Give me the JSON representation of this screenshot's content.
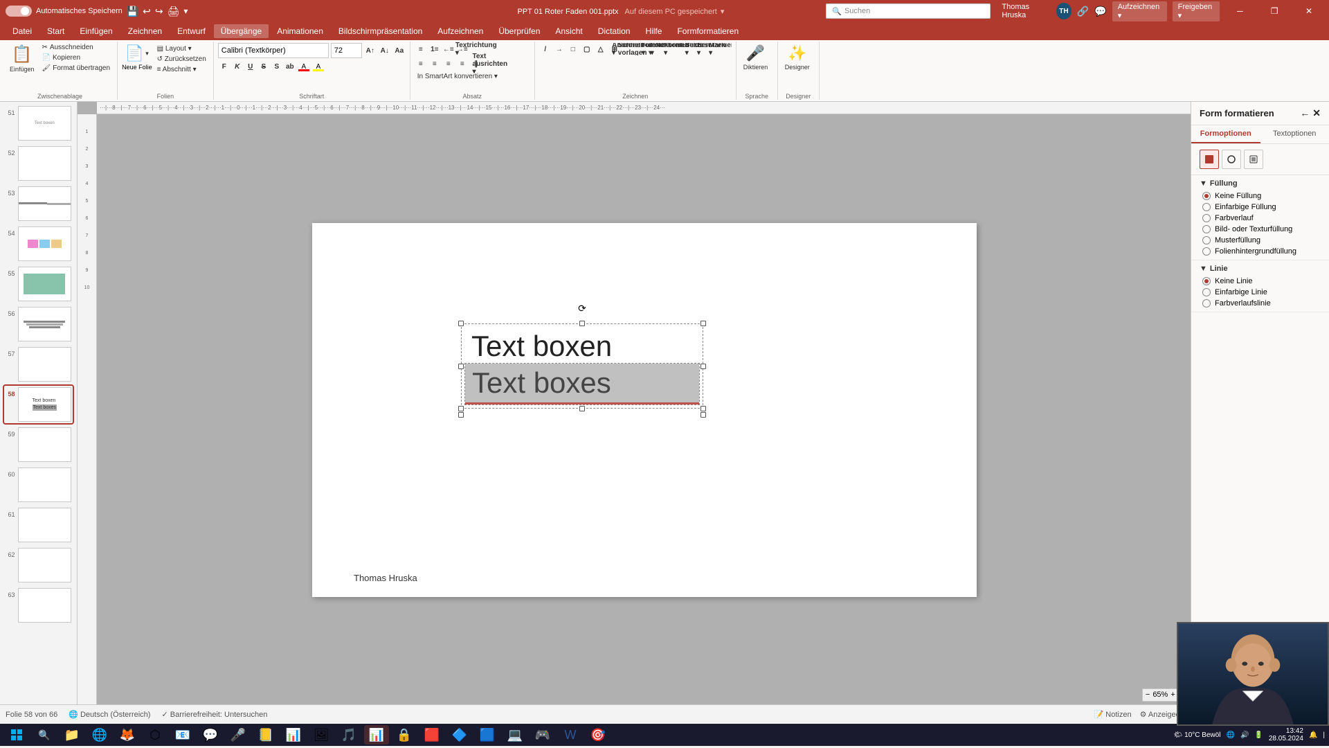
{
  "titlebar": {
    "autosave_label": "Automatisches Speichern",
    "file_title": "PPT 01 Roter Faden 001.pptx",
    "save_location": "Auf diesem PC gespeichert",
    "user_name": "Thomas Hruska",
    "user_initials": "TH",
    "search_placeholder": "Suchen",
    "win_minimize": "─",
    "win_restore": "❐",
    "win_close": "✕"
  },
  "menubar": {
    "items": [
      {
        "label": "Datei",
        "id": "datei"
      },
      {
        "label": "Start",
        "id": "start"
      },
      {
        "label": "Einfügen",
        "id": "einfuegen"
      },
      {
        "label": "Zeichnen",
        "id": "zeichnen"
      },
      {
        "label": "Entwurf",
        "id": "entwurf"
      },
      {
        "label": "Übergänge",
        "id": "uebergaenge",
        "active": true
      },
      {
        "label": "Animationen",
        "id": "animationen"
      },
      {
        "label": "Bildschirmpräsentation",
        "id": "bildschirm"
      },
      {
        "label": "Aufzeichnen",
        "id": "aufzeichnen"
      },
      {
        "label": "Überprüfen",
        "id": "ueberpruefen"
      },
      {
        "label": "Ansicht",
        "id": "ansicht"
      },
      {
        "label": "Dictation",
        "id": "dictation"
      },
      {
        "label": "Hilfe",
        "id": "hilfe"
      },
      {
        "label": "Formformatieren",
        "id": "formformatieren"
      }
    ]
  },
  "ribbon": {
    "active_tab": "Übergänge",
    "groups": [
      {
        "label": "Zwischenablage",
        "buttons": [
          {
            "label": "Neue Folie",
            "icon": "📄"
          },
          {
            "label": "Layout",
            "icon": "▤"
          },
          {
            "label": "Zurücksetzen",
            "icon": "↺"
          },
          {
            "label": "Abschnitt",
            "icon": "≡"
          }
        ]
      }
    ],
    "font_name": "Calibri (Textkörper)",
    "font_size": "72",
    "format_buttons": [
      "F",
      "K",
      "U",
      "S",
      "ab",
      "A"
    ],
    "group_labels": [
      "Zwischenablage",
      "Folien",
      "Schriftart",
      "Absatz",
      "Zeichnen",
      "Sprache",
      "Designer"
    ]
  },
  "slide_panel": {
    "slides": [
      {
        "num": "51",
        "active": false
      },
      {
        "num": "52",
        "active": false
      },
      {
        "num": "53",
        "active": false
      },
      {
        "num": "54",
        "active": false
      },
      {
        "num": "55",
        "active": false
      },
      {
        "num": "56",
        "active": false
      },
      {
        "num": "57",
        "active": false
      },
      {
        "num": "58",
        "active": true
      },
      {
        "num": "59",
        "active": false
      },
      {
        "num": "60",
        "active": false
      },
      {
        "num": "61",
        "active": false
      },
      {
        "num": "62",
        "active": false
      },
      {
        "num": "63",
        "active": false
      }
    ]
  },
  "canvas": {
    "slide_footer": "Thomas Hruska",
    "textbox_upper": "Text boxen",
    "textbox_lower": "Text boxes"
  },
  "right_panel": {
    "title": "Form formatieren",
    "tabs": [
      {
        "label": "Formoptionen",
        "active": true
      },
      {
        "label": "Textoptionen",
        "active": false
      }
    ],
    "shape_icons": [
      "◆",
      "⬡",
      "⊞"
    ],
    "sections": [
      {
        "label": "Füllung",
        "expanded": true,
        "options": [
          {
            "label": "Keine Füllung",
            "checked": true
          },
          {
            "label": "Einfarbige Füllung",
            "checked": false
          },
          {
            "label": "Farbverlauf",
            "checked": false
          },
          {
            "label": "Bild- oder Texturfüllung",
            "checked": false
          },
          {
            "label": "Musterfüllung",
            "checked": false
          },
          {
            "label": "Folienhintergrundfüllung",
            "checked": false
          }
        ]
      },
      {
        "label": "Linie",
        "expanded": true,
        "options": [
          {
            "label": "Keine Linie",
            "checked": true
          },
          {
            "label": "Einfarbige Linie",
            "checked": false
          },
          {
            "label": "Farbverlaufslinie",
            "checked": false
          }
        ]
      }
    ]
  },
  "statusbar": {
    "slide_info": "Folie 58 von 66",
    "language": "Deutsch (Österreich)",
    "accessibility": "Barrierefreiheit: Untersuchen",
    "notes": "Notizen",
    "display_settings": "Anzeigeeinstellungen"
  },
  "taskbar": {
    "apps": [
      "⊞",
      "🔍",
      "📁",
      "🌐",
      "🦊",
      "⬡",
      "📧",
      "💬",
      "🎤",
      "📒",
      "📊",
      "🖼",
      "🎵",
      "📋",
      "🔒",
      "🟥",
      "🔷",
      "🟦",
      "💻",
      "🎮"
    ],
    "system_tray": {
      "weather": "10°C Bewöl",
      "time": "13:42",
      "date": "28.05.2024"
    }
  },
  "colors": {
    "brand_red": "#b03a2e",
    "accent": "#c0504d",
    "selection_blue": "#0078d4"
  }
}
